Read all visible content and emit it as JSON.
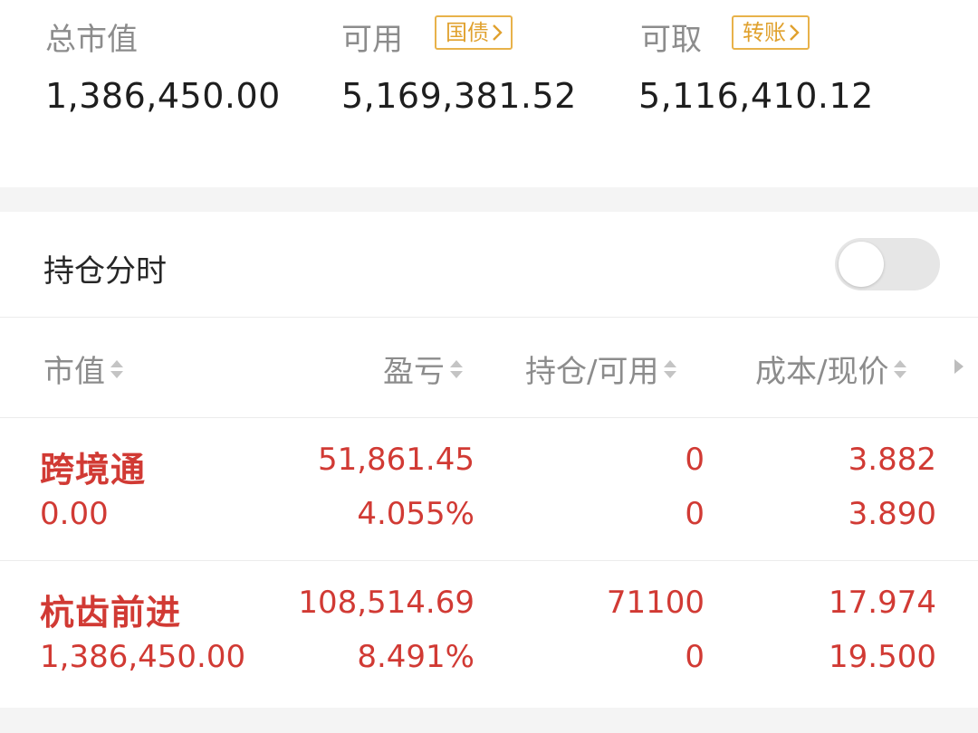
{
  "summary": {
    "market_value": {
      "label": "总市值",
      "value": "1,386,450.00"
    },
    "available": {
      "label": "可用",
      "value": "5,169,381.52",
      "tag": "国债"
    },
    "withdrawable": {
      "label": "可取",
      "value": "5,116,410.12",
      "tag": "转账"
    }
  },
  "position_timeshare": {
    "label": "持仓分时",
    "enabled": false
  },
  "table": {
    "headers": {
      "market_value": "市值",
      "pnl": "盈亏",
      "position_available": "持仓/可用",
      "cost_price": "成本/现价"
    },
    "rows": [
      {
        "name": "跨境通",
        "market_value": "0.00",
        "pnl": "51,861.45",
        "pnl_pct": "4.055%",
        "position": "0",
        "available": "0",
        "cost": "3.882",
        "price": "3.890"
      },
      {
        "name": "杭齿前进",
        "market_value": "1,386,450.00",
        "pnl": "108,514.69",
        "pnl_pct": "8.491%",
        "position": "71100",
        "available": "0",
        "cost": "17.974",
        "price": "19.500"
      }
    ]
  },
  "colors": {
    "profit_red": "#d13a34",
    "tag_gold": "#e0a12e",
    "label_gray": "#8c8c8c"
  }
}
